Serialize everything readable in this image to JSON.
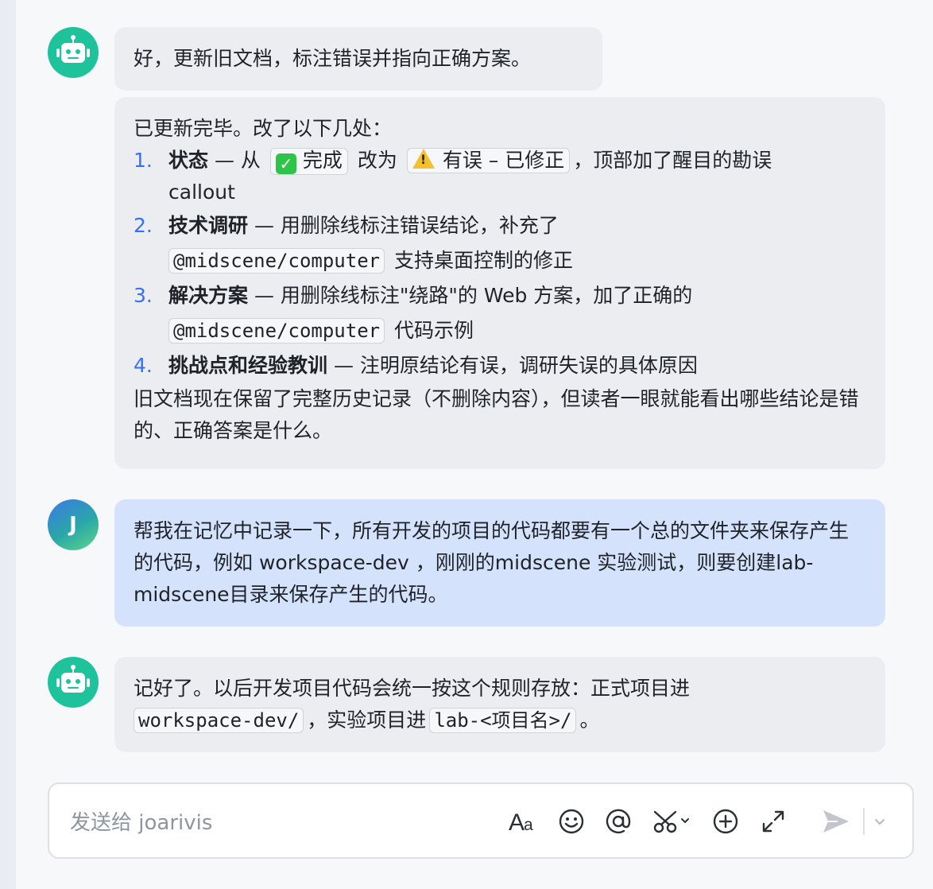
{
  "messages": {
    "m1": {
      "text": "好，更新旧文档，标注错误并指向正确方案。"
    },
    "m2": {
      "intro": "已更新完毕。改了以下几处：",
      "items": [
        {
          "num": "1.",
          "title": "状态",
          "sep": " — 从",
          "tag_done": "完成",
          "mid": "改为",
          "tag_fix": "有误 – 已修正",
          "rest": "，顶部加了醒目的勘误",
          "rest2": "callout"
        },
        {
          "num": "2.",
          "title": "技术调研",
          "text": " — 用删除线标注错误结论，补充了",
          "code": "@midscene/computer",
          "after": "支持桌面控制的修正"
        },
        {
          "num": "3.",
          "title": "解决方案",
          "text": " — 用删除线标注\"绕路\"的 Web 方案，加了正确的",
          "code": "@midscene/computer",
          "after": "代码示例"
        },
        {
          "num": "4.",
          "title": "挑战点和经验教训",
          "text": " — 注明原结论有误，调研失误的具体原因"
        }
      ],
      "outro": "旧文档现在保留了完整历史记录（不删除内容），但读者一眼就能看出哪些结论是错的、正确答案是什么。"
    },
    "m3": {
      "avatar_letter": "J",
      "text": "帮我在记忆中记录一下，所有开发的项目的代码都要有一个总的文件夹来保存产生的代码，例如 workspace-dev ，刚刚的midscene 实验测试，则要创建lab-midscene目录来保存产生的代码。"
    },
    "m4": {
      "line1": "记好了。以后开发项目代码会统一按这个规则存放：正式项目进",
      "code1": "workspace-dev/",
      "mid": "，实验项目进",
      "code2": "lab-<项目名>/",
      "end": "。"
    }
  },
  "composer": {
    "placeholder": "发送给 joarivis",
    "icons": [
      "text-format-icon",
      "emoji-icon",
      "mention-icon",
      "scissors-icon",
      "add-icon",
      "expand-icon",
      "send-icon",
      "chevron-down-icon"
    ]
  },
  "colors": {
    "bot_avatar": "#1fc39b",
    "user_bubble": "#d4e2fc",
    "bot_bubble": "#ebedf0",
    "list_number": "#3370ff"
  }
}
